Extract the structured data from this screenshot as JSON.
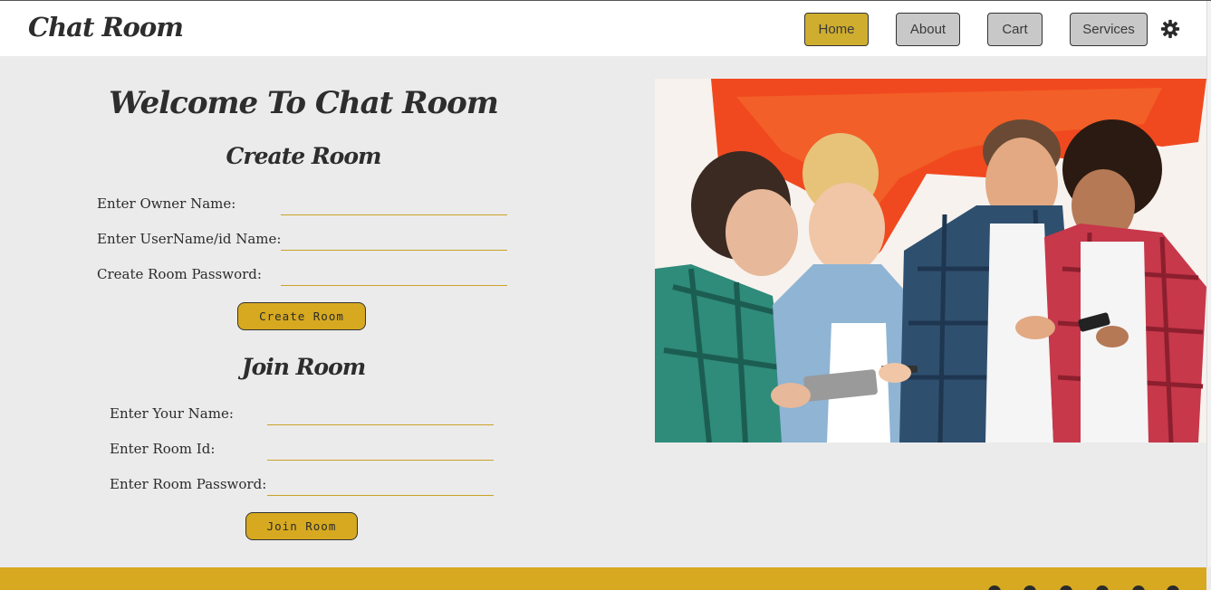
{
  "brand": "Chat Room",
  "nav": {
    "items": [
      {
        "label": "Home",
        "active": true
      },
      {
        "label": "About",
        "active": false
      },
      {
        "label": "Cart",
        "active": false
      },
      {
        "label": "Services",
        "active": false
      }
    ],
    "theme_icon": "gear-icon"
  },
  "main": {
    "welcome_title": "Welcome To Chat Room",
    "create_room": {
      "heading": "Create Room",
      "fields": [
        {
          "label": "Enter Owner Name:",
          "value": ""
        },
        {
          "label": "Enter UserName/id Name:",
          "value": ""
        },
        {
          "label": "Create Room Password:",
          "value": ""
        }
      ],
      "button_label": "Create Room"
    },
    "join_room": {
      "heading": "Join Room",
      "fields": [
        {
          "label": "Enter Your Name:",
          "value": ""
        },
        {
          "label": "Enter Room Id:",
          "value": ""
        },
        {
          "label": "Enter Room Password:",
          "value": ""
        }
      ],
      "button_label": "Join Room"
    }
  },
  "hero_image": "group-of-friends-using-phones-photo",
  "colors": {
    "accent": "#d6a920",
    "active_nav": "#cfae2f",
    "background": "#ebebeb",
    "inactive_nav": "#c8c8c8"
  },
  "footer": {
    "social_icons": [
      "location-icon",
      "twitter-icon",
      "youtube-icon",
      "facebook-icon",
      "instagram-icon",
      "pinterest-icon"
    ]
  }
}
